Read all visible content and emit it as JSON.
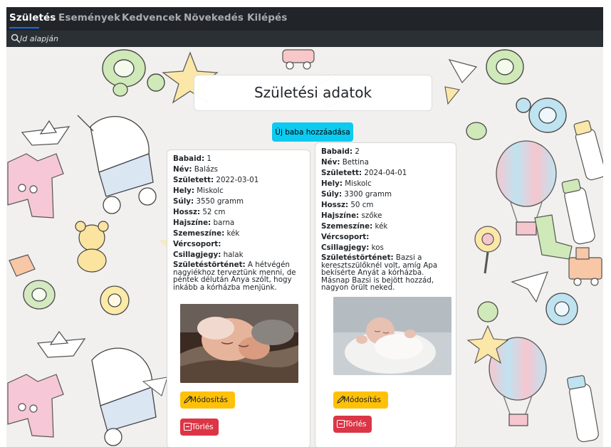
{
  "nav": {
    "items": [
      {
        "label": "Születés",
        "active": true
      },
      {
        "label": "Események",
        "active": false
      },
      {
        "label": "Kedvencek",
        "active": false
      },
      {
        "label": "Növekedés",
        "active": false
      },
      {
        "label": "Kilépés",
        "active": false
      }
    ]
  },
  "search": {
    "placeholder": "Id alapján",
    "value": "",
    "icon": "search-icon"
  },
  "main": {
    "title": "Születési adatok",
    "add_label": "Új baba hozzáadása"
  },
  "cards": [
    {
      "fields": [
        {
          "label": "Babaid:",
          "value": "1"
        },
        {
          "label": "Név:",
          "value": "Balázs"
        },
        {
          "label": "Született:",
          "value": "2022-03-01"
        },
        {
          "label": "Hely:",
          "value": "Miskolc"
        },
        {
          "label": "Súly:",
          "value": "3550 gramm"
        },
        {
          "label": "Hossz:",
          "value": "52 cm"
        },
        {
          "label": "Hajszíne:",
          "value": "barna"
        },
        {
          "label": "Szemeszíne:",
          "value": "kék"
        },
        {
          "label": "Vércsoport:",
          "value": ""
        },
        {
          "label": "Csillagjegy:",
          "value": "halak"
        }
      ],
      "story_label": "Születéstörténet:",
      "story": "A hétvégén nagyiékhoz terveztünk menni, de péntek délután Anya szólt, hogy inkább a kórházba menjünk.",
      "edit_label": "Módosítás",
      "delete_label": "Törlés"
    },
    {
      "fields": [
        {
          "label": "Babaid:",
          "value": "2"
        },
        {
          "label": "Név:",
          "value": "Bettina"
        },
        {
          "label": "Született:",
          "value": "2024-04-01"
        },
        {
          "label": "Hely:",
          "value": "Miskolc"
        },
        {
          "label": "Súly:",
          "value": "3300 gramm"
        },
        {
          "label": "Hossz:",
          "value": "50 cm"
        },
        {
          "label": "Hajszíne:",
          "value": "szőke"
        },
        {
          "label": "Szemeszíne:",
          "value": "kék"
        },
        {
          "label": "Vércsoport:",
          "value": ""
        },
        {
          "label": "Csillagjegy:",
          "value": "kos"
        }
      ],
      "story_label": "Születéstörténet:",
      "story": "Bazsi a keresztszülőknél volt, amíg Apa bekísérte Anyát a kórházba. Másnap Bazsi is bejött hozzád, nagyon örült neked.",
      "edit_label": "Módosítás",
      "delete_label": "Törlés"
    }
  ],
  "colors": {
    "navbar": "#212529",
    "searchbar": "#2b3035",
    "add_button": "#0dcaf0",
    "edit_button": "#ffc107",
    "delete_button": "#dc3545",
    "active_underline": "#0d6efd"
  }
}
